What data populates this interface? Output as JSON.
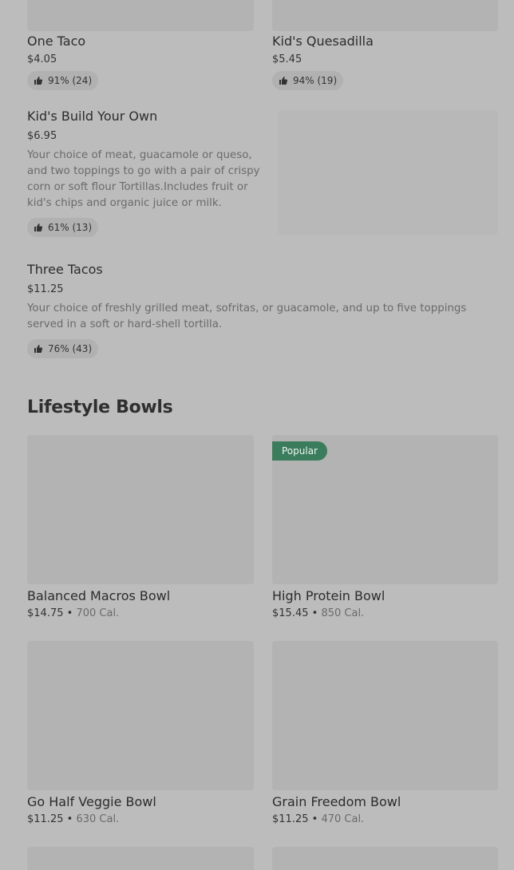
{
  "top_items": [
    {
      "name": "One Taco",
      "price": "$4.05",
      "rating": "91% (24)"
    },
    {
      "name": "Kid's Quesadilla",
      "price": "$5.45",
      "rating": "94% (19)"
    }
  ],
  "kids_build": {
    "name": "Kid's Build Your Own",
    "price": "$6.95",
    "description": "Your choice of meat, guacamole or queso, and two toppings to go with a pair of crispy corn or soft flour Tortillas.Includes fruit or kid's chips and organic juice or milk.",
    "rating": "61% (13)"
  },
  "three_tacos": {
    "name": "Three Tacos",
    "price": "$11.25",
    "description": "Your choice of freshly grilled meat, sofritas, or guacamole, and up to five toppings served in a soft or hard-shell tortilla.",
    "rating": "76% (43)"
  },
  "section": {
    "title": "Lifestyle Bowls"
  },
  "bowls": [
    {
      "name": "Balanced Macros Bowl",
      "price": "$14.75",
      "separator": "•",
      "calories": "700 Cal."
    },
    {
      "name": "High Protein Bowl",
      "price": "$15.45",
      "separator": "•",
      "calories": "850 Cal.",
      "badge": "Popular"
    },
    {
      "name": "Go Half Veggie Bowl",
      "price": "$11.25",
      "separator": "•",
      "calories": "630 Cal."
    },
    {
      "name": "Grain Freedom Bowl",
      "price": "$11.25",
      "separator": "•",
      "calories": "470 Cal."
    }
  ],
  "colors": {
    "background": "#bcbcbc",
    "badge": "#3a7d5c",
    "image_placeholder": "#b3b3b3"
  },
  "icons": {
    "rating": "thumbs-up-icon"
  }
}
